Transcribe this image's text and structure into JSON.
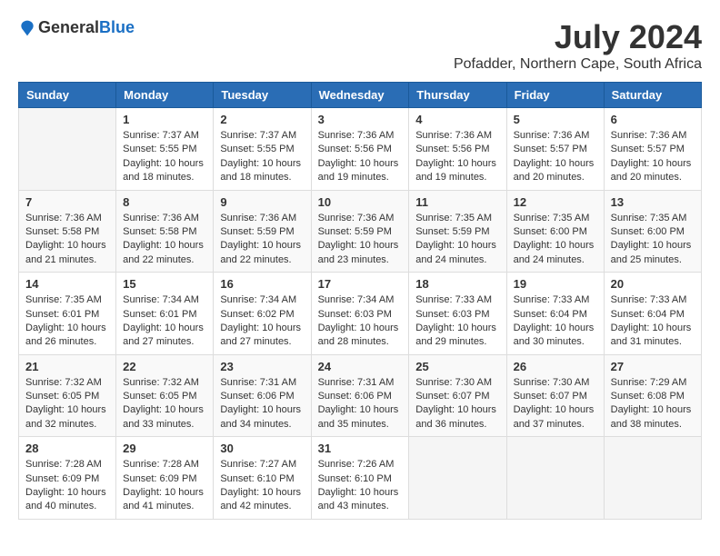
{
  "logo": {
    "general": "General",
    "blue": "Blue"
  },
  "title": {
    "month": "July 2024",
    "location": "Pofadder, Northern Cape, South Africa"
  },
  "headers": [
    "Sunday",
    "Monday",
    "Tuesday",
    "Wednesday",
    "Thursday",
    "Friday",
    "Saturday"
  ],
  "weeks": [
    [
      {
        "day": "",
        "sunrise": "",
        "sunset": "",
        "daylight": ""
      },
      {
        "day": "1",
        "sunrise": "Sunrise: 7:37 AM",
        "sunset": "Sunset: 5:55 PM",
        "daylight": "Daylight: 10 hours and 18 minutes."
      },
      {
        "day": "2",
        "sunrise": "Sunrise: 7:37 AM",
        "sunset": "Sunset: 5:55 PM",
        "daylight": "Daylight: 10 hours and 18 minutes."
      },
      {
        "day": "3",
        "sunrise": "Sunrise: 7:36 AM",
        "sunset": "Sunset: 5:56 PM",
        "daylight": "Daylight: 10 hours and 19 minutes."
      },
      {
        "day": "4",
        "sunrise": "Sunrise: 7:36 AM",
        "sunset": "Sunset: 5:56 PM",
        "daylight": "Daylight: 10 hours and 19 minutes."
      },
      {
        "day": "5",
        "sunrise": "Sunrise: 7:36 AM",
        "sunset": "Sunset: 5:57 PM",
        "daylight": "Daylight: 10 hours and 20 minutes."
      },
      {
        "day": "6",
        "sunrise": "Sunrise: 7:36 AM",
        "sunset": "Sunset: 5:57 PM",
        "daylight": "Daylight: 10 hours and 20 minutes."
      }
    ],
    [
      {
        "day": "7",
        "sunrise": "Sunrise: 7:36 AM",
        "sunset": "Sunset: 5:58 PM",
        "daylight": "Daylight: 10 hours and 21 minutes."
      },
      {
        "day": "8",
        "sunrise": "Sunrise: 7:36 AM",
        "sunset": "Sunset: 5:58 PM",
        "daylight": "Daylight: 10 hours and 22 minutes."
      },
      {
        "day": "9",
        "sunrise": "Sunrise: 7:36 AM",
        "sunset": "Sunset: 5:59 PM",
        "daylight": "Daylight: 10 hours and 22 minutes."
      },
      {
        "day": "10",
        "sunrise": "Sunrise: 7:36 AM",
        "sunset": "Sunset: 5:59 PM",
        "daylight": "Daylight: 10 hours and 23 minutes."
      },
      {
        "day": "11",
        "sunrise": "Sunrise: 7:35 AM",
        "sunset": "Sunset: 5:59 PM",
        "daylight": "Daylight: 10 hours and 24 minutes."
      },
      {
        "day": "12",
        "sunrise": "Sunrise: 7:35 AM",
        "sunset": "Sunset: 6:00 PM",
        "daylight": "Daylight: 10 hours and 24 minutes."
      },
      {
        "day": "13",
        "sunrise": "Sunrise: 7:35 AM",
        "sunset": "Sunset: 6:00 PM",
        "daylight": "Daylight: 10 hours and 25 minutes."
      }
    ],
    [
      {
        "day": "14",
        "sunrise": "Sunrise: 7:35 AM",
        "sunset": "Sunset: 6:01 PM",
        "daylight": "Daylight: 10 hours and 26 minutes."
      },
      {
        "day": "15",
        "sunrise": "Sunrise: 7:34 AM",
        "sunset": "Sunset: 6:01 PM",
        "daylight": "Daylight: 10 hours and 27 minutes."
      },
      {
        "day": "16",
        "sunrise": "Sunrise: 7:34 AM",
        "sunset": "Sunset: 6:02 PM",
        "daylight": "Daylight: 10 hours and 27 minutes."
      },
      {
        "day": "17",
        "sunrise": "Sunrise: 7:34 AM",
        "sunset": "Sunset: 6:03 PM",
        "daylight": "Daylight: 10 hours and 28 minutes."
      },
      {
        "day": "18",
        "sunrise": "Sunrise: 7:33 AM",
        "sunset": "Sunset: 6:03 PM",
        "daylight": "Daylight: 10 hours and 29 minutes."
      },
      {
        "day": "19",
        "sunrise": "Sunrise: 7:33 AM",
        "sunset": "Sunset: 6:04 PM",
        "daylight": "Daylight: 10 hours and 30 minutes."
      },
      {
        "day": "20",
        "sunrise": "Sunrise: 7:33 AM",
        "sunset": "Sunset: 6:04 PM",
        "daylight": "Daylight: 10 hours and 31 minutes."
      }
    ],
    [
      {
        "day": "21",
        "sunrise": "Sunrise: 7:32 AM",
        "sunset": "Sunset: 6:05 PM",
        "daylight": "Daylight: 10 hours and 32 minutes."
      },
      {
        "day": "22",
        "sunrise": "Sunrise: 7:32 AM",
        "sunset": "Sunset: 6:05 PM",
        "daylight": "Daylight: 10 hours and 33 minutes."
      },
      {
        "day": "23",
        "sunrise": "Sunrise: 7:31 AM",
        "sunset": "Sunset: 6:06 PM",
        "daylight": "Daylight: 10 hours and 34 minutes."
      },
      {
        "day": "24",
        "sunrise": "Sunrise: 7:31 AM",
        "sunset": "Sunset: 6:06 PM",
        "daylight": "Daylight: 10 hours and 35 minutes."
      },
      {
        "day": "25",
        "sunrise": "Sunrise: 7:30 AM",
        "sunset": "Sunset: 6:07 PM",
        "daylight": "Daylight: 10 hours and 36 minutes."
      },
      {
        "day": "26",
        "sunrise": "Sunrise: 7:30 AM",
        "sunset": "Sunset: 6:07 PM",
        "daylight": "Daylight: 10 hours and 37 minutes."
      },
      {
        "day": "27",
        "sunrise": "Sunrise: 7:29 AM",
        "sunset": "Sunset: 6:08 PM",
        "daylight": "Daylight: 10 hours and 38 minutes."
      }
    ],
    [
      {
        "day": "28",
        "sunrise": "Sunrise: 7:28 AM",
        "sunset": "Sunset: 6:09 PM",
        "daylight": "Daylight: 10 hours and 40 minutes."
      },
      {
        "day": "29",
        "sunrise": "Sunrise: 7:28 AM",
        "sunset": "Sunset: 6:09 PM",
        "daylight": "Daylight: 10 hours and 41 minutes."
      },
      {
        "day": "30",
        "sunrise": "Sunrise: 7:27 AM",
        "sunset": "Sunset: 6:10 PM",
        "daylight": "Daylight: 10 hours and 42 minutes."
      },
      {
        "day": "31",
        "sunrise": "Sunrise: 7:26 AM",
        "sunset": "Sunset: 6:10 PM",
        "daylight": "Daylight: 10 hours and 43 minutes."
      },
      {
        "day": "",
        "sunrise": "",
        "sunset": "",
        "daylight": ""
      },
      {
        "day": "",
        "sunrise": "",
        "sunset": "",
        "daylight": ""
      },
      {
        "day": "",
        "sunrise": "",
        "sunset": "",
        "daylight": ""
      }
    ]
  ]
}
